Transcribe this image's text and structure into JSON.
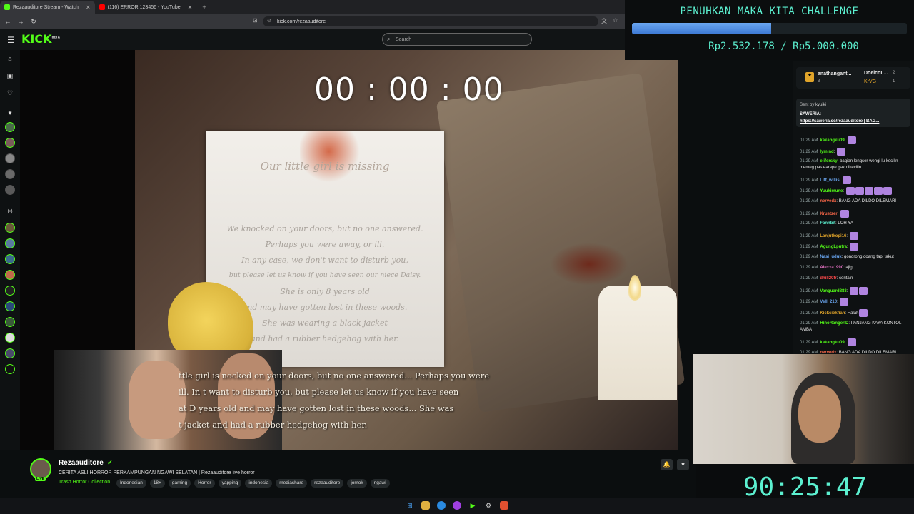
{
  "browser": {
    "tabs": [
      {
        "label": "Rezaauditore Stream - Watch",
        "color": "#53fc18",
        "active": true
      },
      {
        "label": "(116) ERROR 123456 - YouTube",
        "color": "#ff0000",
        "active": false
      }
    ],
    "new_tab": "+",
    "url": "kick.com/rezaauditore"
  },
  "kick": {
    "logo": "KICK",
    "logo_sup": "BETA",
    "search_placeholder": "Search"
  },
  "video": {
    "timer": "00 : 00 : 00",
    "paper_title": "Our little girl is missing",
    "paper_lines": [
      "We knocked on your doors, but no one answered.",
      "Perhaps you were away, or ill.",
      "In any case, we don't want to disturb you,",
      "but please let us know if you have seen our niece Daisy.",
      "She is only 8 years old",
      "and may have gotten lost in these woods.",
      "She was wearing a black jacket",
      "and had a rubber hedgehog with her."
    ],
    "subtitles": [
      "ttle girl is        nocked on your doors, but no one answered... Perhaps you were",
      "ill. In           t want to disturb you, but please let us know if you have seen",
      "at D             years old and may have gotten lost in these woods... She was",
      "                   t jacket and had a rubber hedgehog with her."
    ]
  },
  "stream": {
    "streamer": "Rezaauditore",
    "live_badge": "LIVE",
    "title": "CERITA ASLI HORROR PERKAMPUNGAN NGAWI SELATAN | Rezaauditore live horror",
    "category": "Trash Horror Collection",
    "tags": [
      "Indonesian",
      "18+",
      "gaming",
      "Horror",
      "yapping",
      "indonesia",
      "mediashare",
      "rezaauditore",
      "jomok",
      "ngawi"
    ]
  },
  "challenge": {
    "title": "PENUHKAN MAKA KITA CHALLENGE",
    "amount": "Rp2.532.178 / Rp5.000.000",
    "progress": 0.506
  },
  "chat": {
    "supporters": [
      {
        "name": "anathangant...",
        "count": "3"
      },
      {
        "name": "DoelcoL...",
        "count": "2"
      },
      {
        "name": "KrVG",
        "count": "1"
      }
    ],
    "pinned_head": "Sent by  kyuiki",
    "pinned_label": "SAWERIA:",
    "pinned_link": "https://saweria.co/rezaauditore | BAG...",
    "messages": [
      {
        "time": "01:29 AM",
        "user": "kakangku09",
        "text": "",
        "color": "#53fc18",
        "emotes": 1
      },
      {
        "time": "01:29 AM",
        "user": "lymind",
        "text": "",
        "color": "#53fc18",
        "emotes": 1
      },
      {
        "time": "01:29 AM",
        "user": "elifersky",
        "text": "bagian lengser wengi lu kecilin memeg pas earape gak dikecilin",
        "color": "#53fc18",
        "emotes": 0
      },
      {
        "time": "01:29 AM",
        "user": "Liff_willis",
        "text": "",
        "color": "#6aa6f0",
        "emotes": 1
      },
      {
        "time": "01:29 AM",
        "user": "Yuukimune",
        "text": "",
        "color": "#53fc18",
        "emotes": 5
      },
      {
        "time": "01:29 AM",
        "user": "nervedx",
        "text": "BANG ADA DILDO DILEMARI",
        "color": "#ff6a4a",
        "emotes": 0
      },
      {
        "time": "01:29 AM",
        "user": "Kruetzer",
        "text": "",
        "color": "#ff6a4a",
        "emotes": 1
      },
      {
        "time": "01:29 AM",
        "user": "Fannbit",
        "text": "LOH YA",
        "color": "#5cf0d0",
        "emotes": 0
      },
      {
        "time": "01:29 AM",
        "user": "Lanjutkopi16",
        "text": "",
        "color": "#e0a42a",
        "emotes": 1
      },
      {
        "time": "01:29 AM",
        "user": "AgungLputra",
        "text": "",
        "color": "#53fc18",
        "emotes": 1
      },
      {
        "time": "01:29 AM",
        "user": "Nasi_uduk",
        "text": "gondrong doang tapi takut",
        "color": "#6aa6f0",
        "emotes": 0
      },
      {
        "time": "01:29 AM",
        "user": "Alexxa1990",
        "text": "ajig",
        "color": "#e070c0",
        "emotes": 0
      },
      {
        "time": "01:29 AM",
        "user": "dhill20fr",
        "text": "ceritain",
        "color": "#ff4a4a",
        "emotes": 0
      },
      {
        "time": "01:29 AM",
        "user": "Vanguard888",
        "text": "",
        "color": "#53fc18",
        "emotes": 2
      },
      {
        "time": "01:29 AM",
        "user": "Vell_210",
        "text": "",
        "color": "#6aa6f0",
        "emotes": 1
      },
      {
        "time": "01:29 AM",
        "user": "Kickciekfian",
        "text": "Halah",
        "color": "#e0a42a",
        "emotes": 1
      },
      {
        "time": "01:29 AM",
        "user": "HinoRangerID",
        "text": "PANJANG KAYA KONTOL AMBA",
        "color": "#53fc18",
        "emotes": 0
      },
      {
        "time": "01:29 AM",
        "user": "kakangku09",
        "text": "",
        "color": "#53fc18",
        "emotes": 1
      },
      {
        "time": "01:29 AM",
        "user": "nervedx",
        "text": "BANG ADA DILDO DILEMARI",
        "color": "#ff6a4a",
        "emotes": 0
      }
    ]
  },
  "countdown": "90:25:47",
  "colors": {
    "kick_green": "#53fc18",
    "overlay_cyan": "#5cf0d0",
    "progress_blue": "#3c78d4"
  }
}
